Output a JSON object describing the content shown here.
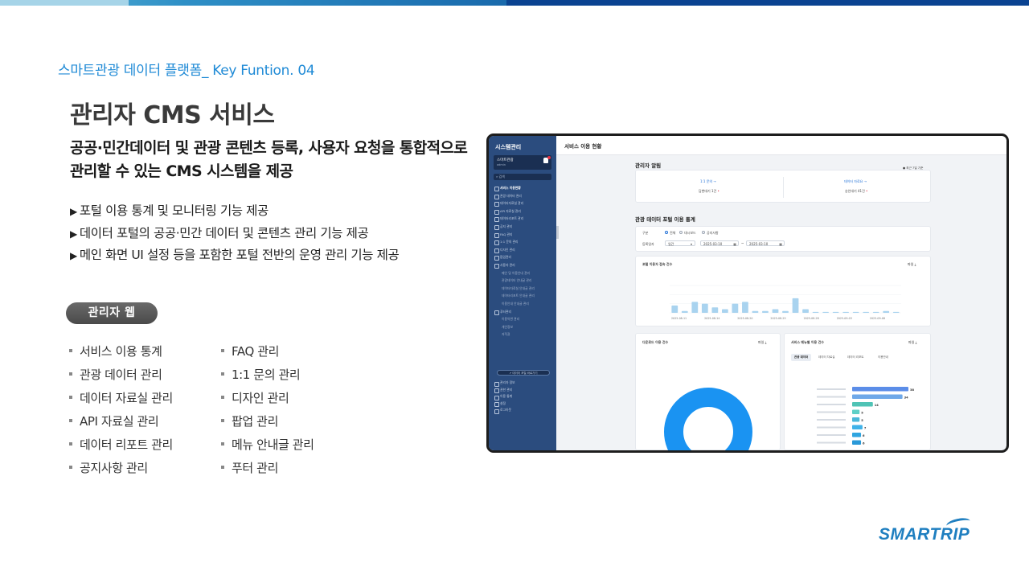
{
  "kicker": "스마트관광 데이터 플랫폼_ Key Funtion. 04",
  "title": "관리자 CMS 서비스",
  "description": [
    "공공·민간데이터 및 관광 콘텐츠 등록, 사용자 요청을 통합적으로",
    "관리할 수 있는 CMS 시스템을 제공"
  ],
  "features": [
    "포털 이용 통계 및 모니터링 기능 제공",
    "데이터 포털의 공공·민간 데이터 및 콘텐츠 관리 기능 제공",
    "메인 화면 UI 설정 등을 포함한 포털 전반의 운영 관리 기능 제공"
  ],
  "web_label": "관리자  웹",
  "menu_col1": [
    "서비스 이용 통계",
    "관광 데이터 관리",
    "데이터 자료실 관리",
    "API 자료실 관리",
    "데이터 리포트 관리",
    "공지사항 관리"
  ],
  "menu_col2": [
    "FAQ 관리",
    "1:1 문의 관리",
    "디자인 관리",
    "팝업 관리",
    "메뉴 안내글 관리",
    "푸터 관리"
  ],
  "screen": {
    "sidebar_title": "시스템관리",
    "page_title": "서비스 이용 현황",
    "alert_title": "관리자 알림",
    "alert_period": "● 최근 7일 기준",
    "alert_left_link": "1:1 문의 →",
    "alert_left_value": "답변대기 1건",
    "alert_right_link": "데이터 자료요 →",
    "alert_right_value": "승인대기 41건",
    "stats_title": "관광 데이터 포털 이용 통계",
    "filter_type_label": "구분",
    "filter_type_options": [
      "전체",
      "대시보드",
      "공지사항"
    ],
    "filter_date_label": "등록일자",
    "filter_unit": "일간",
    "date_from": "2025-03-10",
    "date_to": "2025-03-10",
    "chart_title": "포털 이용자 접속 건수",
    "download_label": "파일 ⤓",
    "donut_title": "다운로드 이용 건수",
    "menu_title": "서비스 메뉴별 이용 건수",
    "menu_tabs": [
      "관광 데이터",
      "데이터 자료실",
      "데이터 리포트",
      "이용안내"
    ]
  },
  "brand": "SMARTRIP",
  "chart_data": [
    {
      "type": "bar",
      "title": "포털 이용자 접속 건수",
      "x_ticks": [
        "2025-08-11",
        "2025-08-14",
        "2025-08-20",
        "2025-08-25",
        "2025-08-28",
        "2025-09-03",
        "2025-09-08"
      ],
      "values": [
        4,
        1,
        6,
        5,
        3,
        2,
        5,
        6,
        1,
        1,
        2,
        1,
        8,
        2,
        0.5,
        0.5,
        0.5,
        0.5,
        0.5,
        0.5,
        0.5,
        1,
        0.5
      ],
      "ylim": [
        0,
        15
      ],
      "color": "#a9d3ef"
    },
    {
      "type": "pie",
      "title": "다운로드 이용 건수",
      "values": [
        1
      ],
      "color": "#1a93f2"
    },
    {
      "type": "bar",
      "title": "서비스 메뉴별 이용 건수",
      "orientation": "horizontal",
      "values": [
        38,
        34,
        14,
        5,
        5,
        7,
        6,
        6
      ],
      "colors": [
        "#5b8de8",
        "#6fa8e8",
        "#4fc3b5",
        "#5fd0c7",
        "#4bb7d9",
        "#3fb2e8",
        "#2fa5e0",
        "#2a99d8"
      ]
    }
  ]
}
